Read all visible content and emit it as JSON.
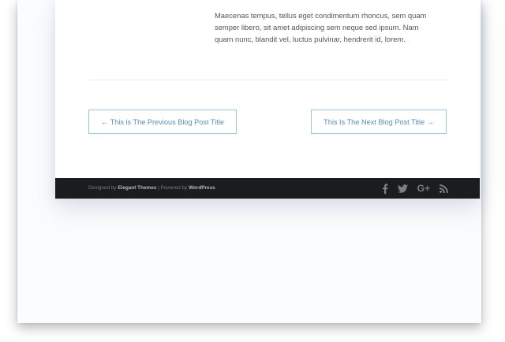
{
  "post": {
    "lines": [
      "Maecenas tempus, tellus eget condimentum rhoncus, sem quam",
      "semper libero, sit amet adipiscing sem neque sed ipsum. Nam",
      "quam nunc, blandit vel, luctus pulvinar, hendrerit id, lorem."
    ]
  },
  "navigation": {
    "previous_label": "← This is The Previous Blog Post Title",
    "next_label": "This Is The Next Blog Post Title →"
  },
  "footer": {
    "designed_by_prefix": "Designed by",
    "designer": "Elegant Themes",
    "separator": " | Powered by ",
    "platform": "WordPress",
    "social": [
      {
        "icon": "facebook-icon",
        "glyph": "f"
      },
      {
        "icon": "twitter-icon",
        "glyph": "twitter"
      },
      {
        "icon": "google-plus-icon",
        "glyph": "G+"
      },
      {
        "icon": "rss-icon",
        "glyph": "rss"
      }
    ]
  },
  "colors": {
    "footer_bg": "#1b1c1e",
    "link_accent": "#5b8fb3",
    "button_border": "#9fc4d7"
  }
}
